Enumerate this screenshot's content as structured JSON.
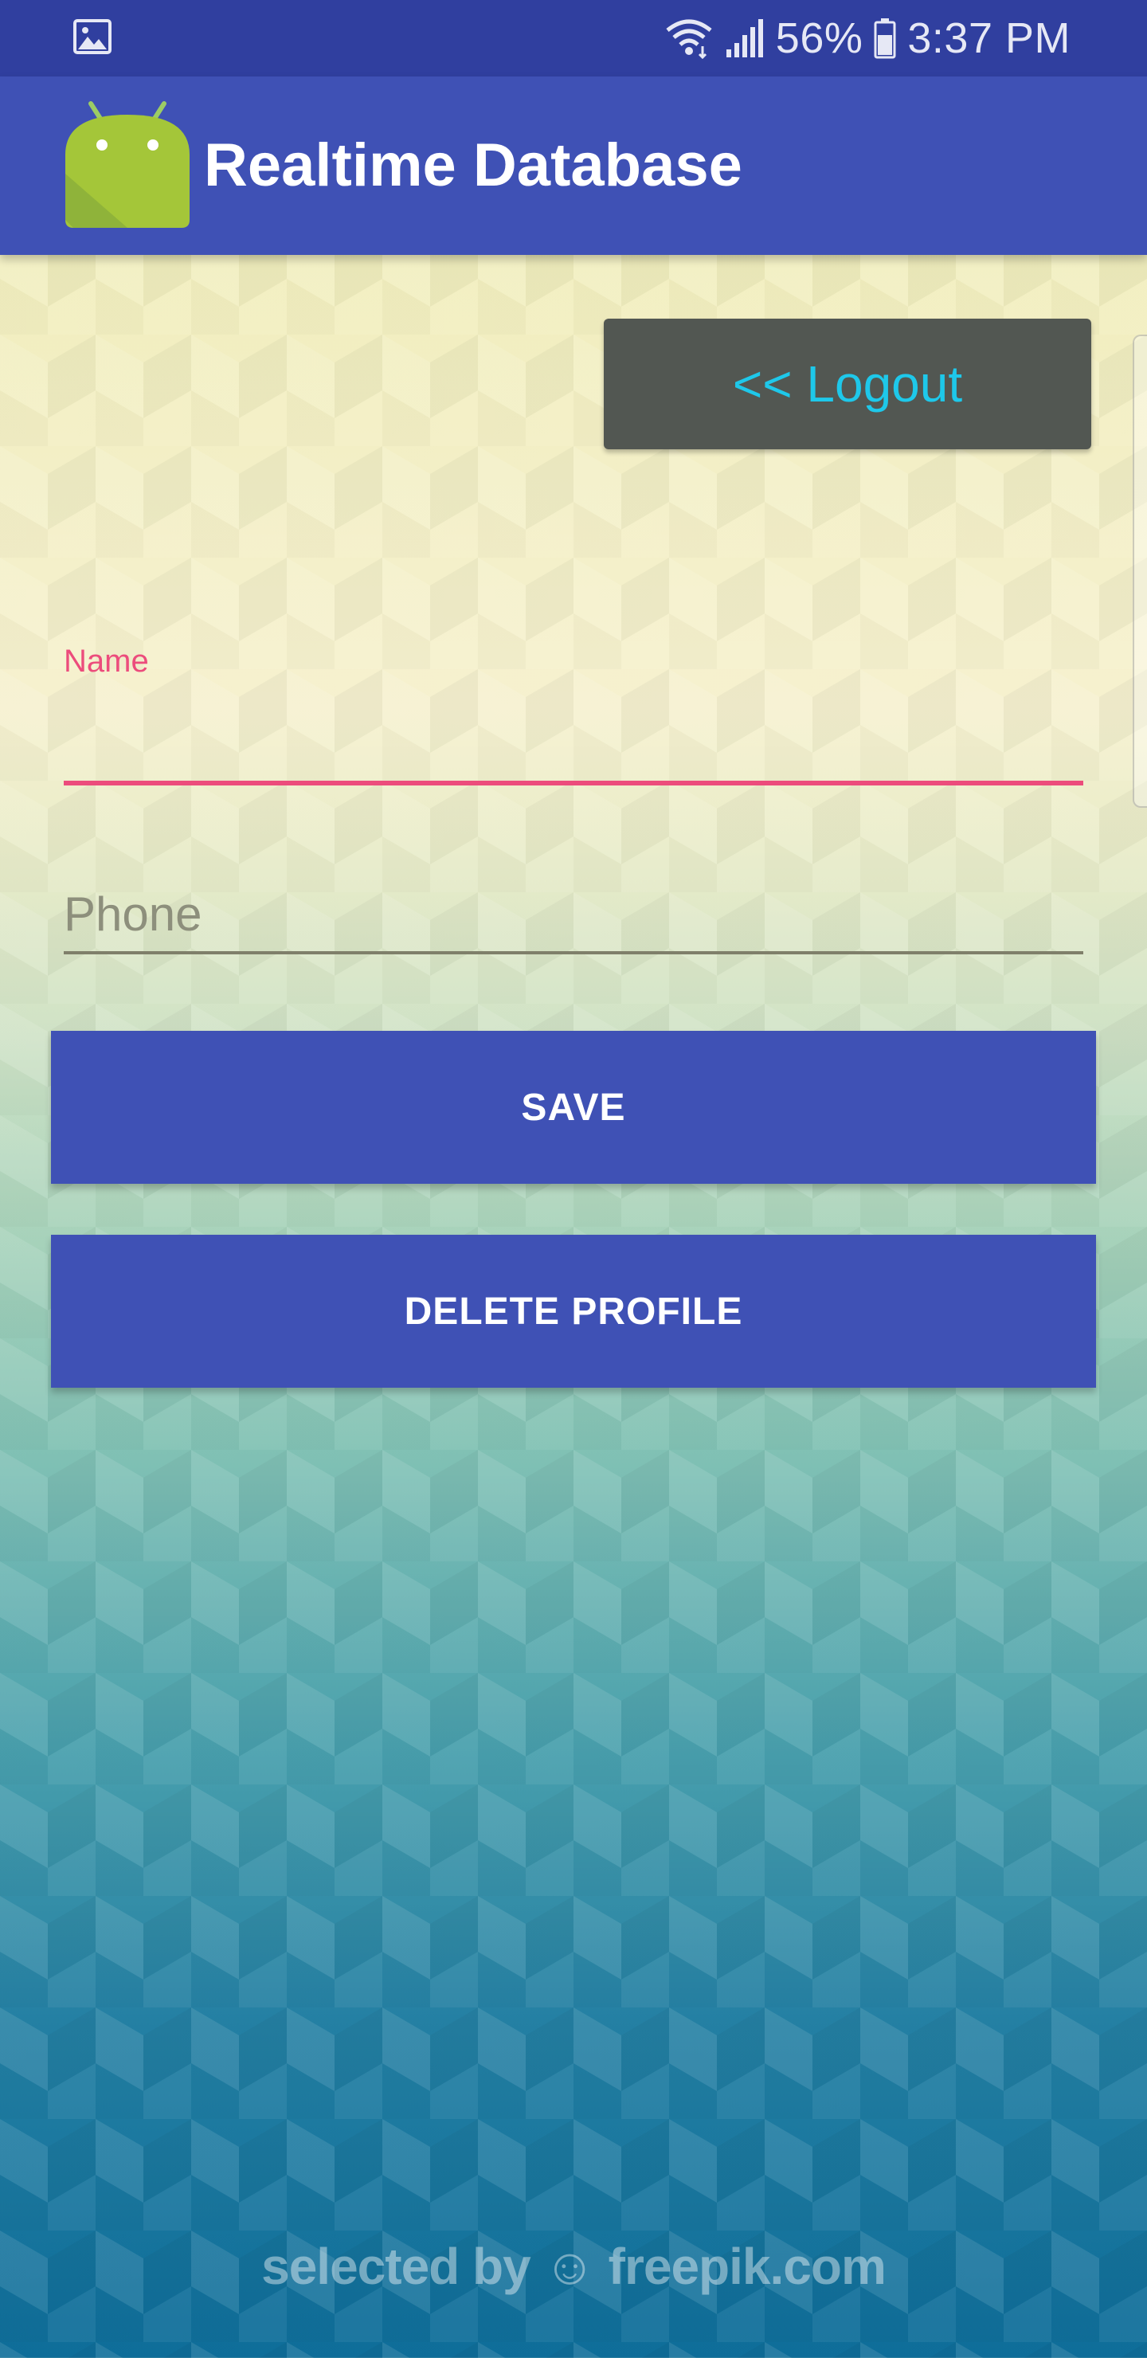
{
  "status_bar": {
    "battery": "56%",
    "time": "3:37 PM",
    "icons": [
      "gallery-icon",
      "wifi-icon",
      "signal-icon",
      "battery-icon"
    ]
  },
  "app_bar": {
    "title": "Realtime Database",
    "logo_icon": "android-logo-icon",
    "color": "#3f51b5"
  },
  "logout": {
    "label": "<< Logout",
    "text_color": "#1ec8ea",
    "background": "#525752"
  },
  "form": {
    "name_label": "Name",
    "name_value": "",
    "phone_placeholder": "Phone",
    "phone_value": "",
    "accent_color": "#ec4c7c"
  },
  "buttons": {
    "save_label": "SAVE",
    "delete_label": "DELETE PROFILE",
    "color": "#3f51b5"
  },
  "background": {
    "watermark": "selected by ☺ freepik.com"
  }
}
